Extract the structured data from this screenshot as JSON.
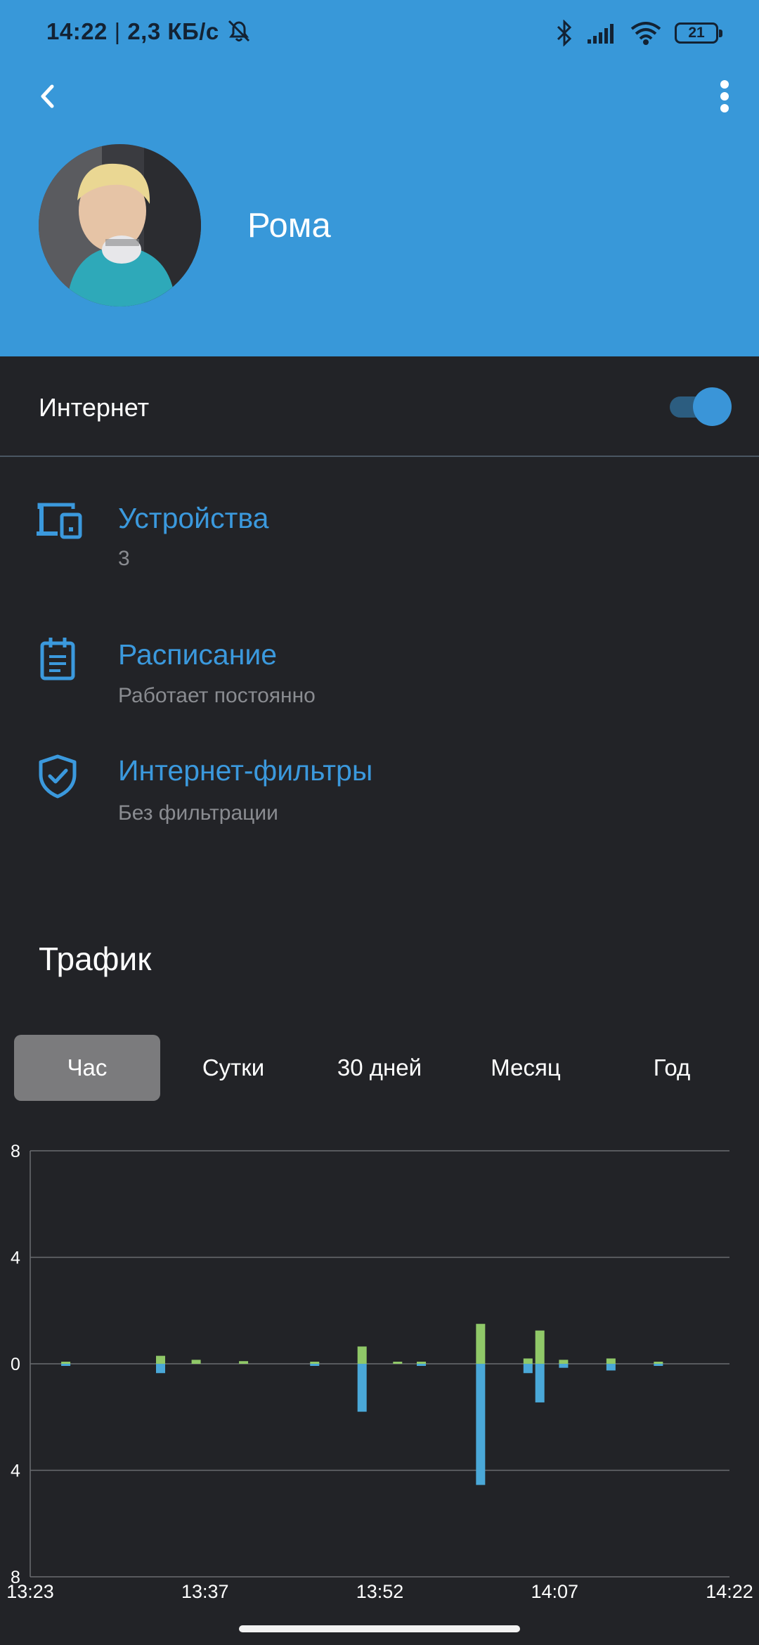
{
  "status_bar": {
    "time": "14:22",
    "separator": "|",
    "network_speed": "2,3 КБ/с",
    "battery_level": "21",
    "icons": [
      "bell-off-icon",
      "bluetooth-icon",
      "signal-icon",
      "wifi-icon",
      "battery-icon"
    ]
  },
  "header": {
    "back_icon": "chevron-left-icon",
    "menu_icon": "more-vertical-icon",
    "profile_name": "Рома",
    "background_color": "#3898d9"
  },
  "internet": {
    "label": "Интернет",
    "enabled": true
  },
  "menu": [
    {
      "icon": "devices-icon",
      "title": "Устройства",
      "subtitle": "3"
    },
    {
      "icon": "schedule-icon",
      "title": "Расписание",
      "subtitle": "Работает постоянно"
    },
    {
      "icon": "shield-check-icon",
      "title": "Интернет-фильтры",
      "subtitle": "Без фильтрации"
    }
  ],
  "traffic": {
    "title": "Трафик",
    "tabs": [
      "Час",
      "Сутки",
      "30 дней",
      "Месяц",
      "Год"
    ],
    "active_tab": 0
  },
  "chart_data": {
    "type": "bar",
    "title": "",
    "xlabel": "",
    "ylabel": "",
    "ylim": [
      -8,
      8
    ],
    "y_ticks": [
      8,
      4,
      0,
      4,
      8
    ],
    "x_tick_labels": [
      "13:23",
      "13:37",
      "13:52",
      "14:07",
      "14:22"
    ],
    "x_range_minutes": [
      0,
      59
    ],
    "grid": true,
    "series": [
      {
        "color": "#90c868",
        "direction": "up",
        "points": [
          {
            "t": 3,
            "v": 0.05
          },
          {
            "t": 11,
            "v": 0.3
          },
          {
            "t": 14,
            "v": 0.15
          },
          {
            "t": 18,
            "v": 0.1
          },
          {
            "t": 24,
            "v": 0.05
          },
          {
            "t": 28,
            "v": 0.65
          },
          {
            "t": 31,
            "v": 0.05
          },
          {
            "t": 33,
            "v": 0.05
          },
          {
            "t": 38,
            "v": 1.5
          },
          {
            "t": 42,
            "v": 0.2
          },
          {
            "t": 43,
            "v": 1.25
          },
          {
            "t": 45,
            "v": 0.15
          },
          {
            "t": 49,
            "v": 0.2
          },
          {
            "t": 53,
            "v": 0.05
          }
        ]
      },
      {
        "color": "#4aa8d8",
        "direction": "down",
        "points": [
          {
            "t": 3,
            "v": 0.05
          },
          {
            "t": 11,
            "v": 0.35
          },
          {
            "t": 24,
            "v": 0.05
          },
          {
            "t": 28,
            "v": 1.8
          },
          {
            "t": 33,
            "v": 0.05
          },
          {
            "t": 38,
            "v": 4.55
          },
          {
            "t": 42,
            "v": 0.35
          },
          {
            "t": 43,
            "v": 1.45
          },
          {
            "t": 45,
            "v": 0.15
          },
          {
            "t": 49,
            "v": 0.25
          },
          {
            "t": 53,
            "v": 0.05
          }
        ]
      }
    ]
  }
}
